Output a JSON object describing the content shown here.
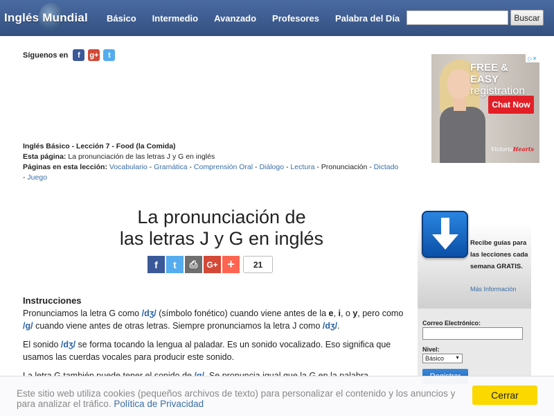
{
  "header": {
    "logo": "Inglés Mundial",
    "nav": [
      "Básico",
      "Intermedio",
      "Avanzado",
      "Profesores",
      "Palabra del Día"
    ],
    "search_button": "Buscar"
  },
  "follow": {
    "label": "Síguenos en",
    "icons": [
      "facebook-icon",
      "google-plus-icon",
      "twitter-icon"
    ]
  },
  "ad": {
    "headline": "FREE & EASY",
    "subheadline": "registration",
    "cta": "Chat Now",
    "brand_left": "Victoria",
    "brand_right": "Hearts"
  },
  "lesson": {
    "line1": "Inglés Básico - Lección 7 - Food (la Comida)",
    "line2_label": "Esta página:",
    "line2_value": "La pronunciación de las letras J y G en inglés",
    "line3_label": "Páginas en esta lección:",
    "pages": [
      "Vocabulario",
      "Gramática",
      "Comprensión Oral",
      "Diálogo",
      "Lectura",
      "Pronunciación",
      "Dictado",
      "Juego"
    ],
    "current_page": "Pronunciación"
  },
  "title": {
    "line1": "La pronunciación de",
    "line2": "las letras J y G en inglés"
  },
  "share": {
    "count": "21"
  },
  "content": {
    "heading": "Instrucciones",
    "p1_a": "Pronunciamos la letra G como ",
    "p1_ipa1": "/dʒ/",
    "p1_b": " (símbolo fonético) cuando viene antes de la ",
    "p1_e": "e",
    "p1_c": ", ",
    "p1_i": "i",
    "p1_d": ", o ",
    "p1_y": "y",
    "p1_e2": ", pero como ",
    "p1_ipa2": "/g/",
    "p1_f": " cuando viene antes de otras letras. Siempre pronunciamos la letra J como ",
    "p1_ipa3": "/dʒ/",
    "p1_g": ".",
    "p2_a": "El sonido ",
    "p2_ipa": "/dʒ/",
    "p2_b": " se forma tocando la lengua al paladar. Es un sonido vocalizado. Eso significa que usamos las cuerdas vocales para producir este sonido.",
    "p3_a": "La letra G también puede tener el sonido de ",
    "p3_ipa": "/g/",
    "p3_b": ". Se pronuncia igual que la G en la palabra"
  },
  "newsletter": {
    "text": "Recibe guías para las lecciones cada semana GRATIS.",
    "more": "Más Información",
    "email_label": "Correo Electrónico:",
    "level_label": "Nivel:",
    "level_value": "Básico",
    "button": "Registrar"
  },
  "cookie": {
    "text": "Este sitio web utiliza cookies (pequeños archivos de texto) para personalizar el contenido y los anuncios y para analizar el tráfico.",
    "link": "Política de Privacidad",
    "button": "Cerrar"
  }
}
